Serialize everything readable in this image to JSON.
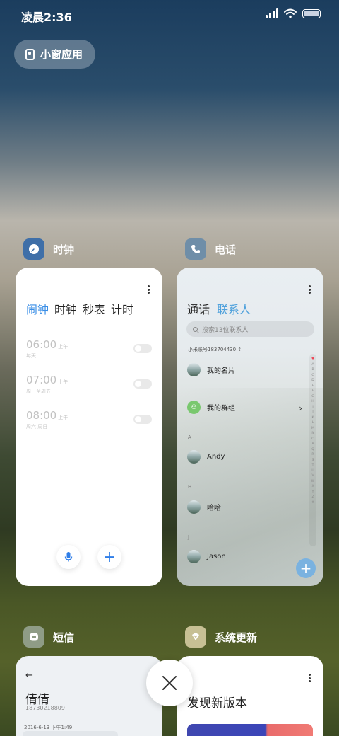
{
  "status_bar": {
    "time": "凌晨2:36"
  },
  "small_window": {
    "label": "小窗应用"
  },
  "apps": {
    "clock": {
      "name": "时钟",
      "tabs": [
        "闹钟",
        "时钟",
        "秒表",
        "计时"
      ],
      "alarms": [
        {
          "time": "06:00",
          "ampm": "上午",
          "days": "每天"
        },
        {
          "time": "07:00",
          "ampm": "上午",
          "days": "周一至周五"
        },
        {
          "time": "08:00",
          "ampm": "上午",
          "days": "周六 周日"
        }
      ]
    },
    "phone": {
      "name": "电话",
      "tabs": [
        "通话",
        "联系人"
      ],
      "search_placeholder": "搜索13位联系人",
      "account": "小米账号183704430",
      "my_card": "我的名片",
      "my_groups": "我的群组",
      "sections": [
        {
          "letter": "A",
          "contact": "Andy"
        },
        {
          "letter": "H",
          "contact": "哈哈"
        },
        {
          "letter": "J",
          "contact": "Jason"
        }
      ],
      "index": [
        "♥",
        "A",
        "B",
        "C",
        "D",
        "E",
        "F",
        "G",
        "H",
        "I",
        "J",
        "K",
        "L",
        "M",
        "N",
        "O",
        "P",
        "Q",
        "R",
        "S",
        "T",
        "U",
        "V",
        "W",
        "X",
        "Y",
        "Z",
        "#"
      ]
    },
    "messages": {
      "name": "短信",
      "contact_name": "倩倩",
      "contact_number": "18730218809",
      "date": "2016-6-13 下午1:49"
    },
    "update": {
      "name": "系统更新",
      "title": "发现新版本"
    }
  },
  "colors": {
    "accent": "#3a8ee6",
    "clock_icon": "#3f6fa8",
    "phone_icon": "#6f8ea8",
    "sms_icon": "#8f9c86",
    "update_icon": "#c7c094"
  }
}
